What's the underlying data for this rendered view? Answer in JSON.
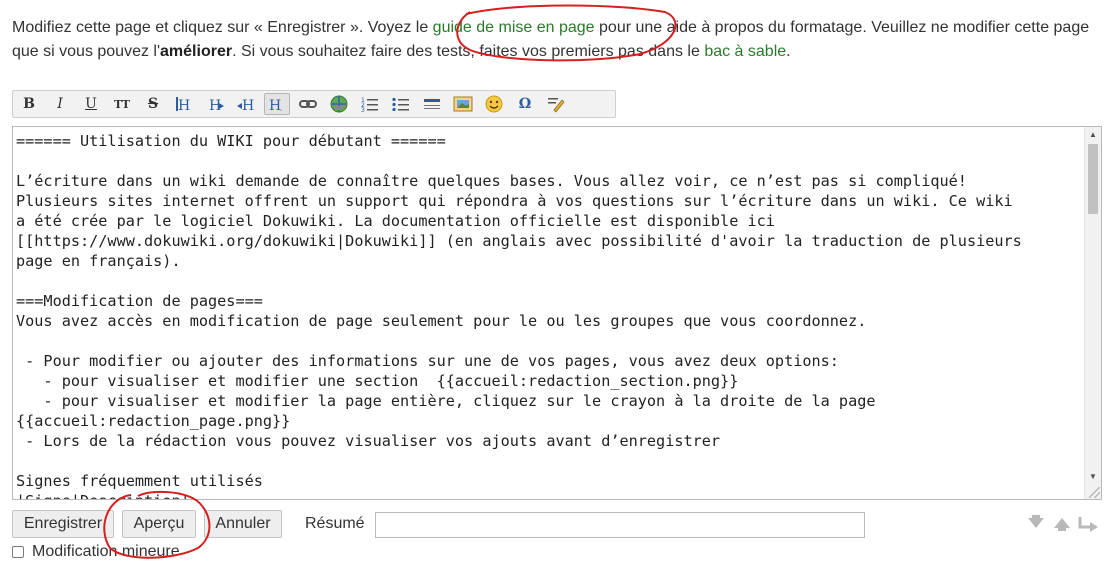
{
  "intro": {
    "t1": "Modifiez cette page et cliquez sur « Enregistrer ». Voyez le ",
    "link1": "guide de mise en page",
    "t2": " pour une aide à propos du formatage. Veuillez ne modifier cette page que si vous pouvez l'",
    "bold": "améliorer",
    "t3": ". Si vous souhaitez faire des tests, faites vos premiers pas dans le ",
    "link2": "bac à sable",
    "t4": "."
  },
  "toolbar": [
    {
      "name": "bold-button",
      "label": "B"
    },
    {
      "name": "italic-button",
      "label": "I"
    },
    {
      "name": "underline-button",
      "label": "U"
    },
    {
      "name": "monospace-button",
      "label": "TT"
    },
    {
      "name": "strikethrough-button",
      "label": "S"
    },
    {
      "name": "same-level-headline-button",
      "label": "H"
    },
    {
      "name": "lower-headline-button",
      "label": "H"
    },
    {
      "name": "higher-headline-button",
      "label": "H"
    },
    {
      "name": "headline-menu-button",
      "label": "H"
    },
    {
      "name": "internal-link-button",
      "label": "∞"
    },
    {
      "name": "external-link-button",
      "label": "◉"
    },
    {
      "name": "ordered-list-button",
      "label": "≡"
    },
    {
      "name": "unordered-list-button",
      "label": "≡"
    },
    {
      "name": "horizontal-rule-button",
      "label": "—"
    },
    {
      "name": "add-image-button",
      "label": "▣"
    },
    {
      "name": "smileys-button",
      "label": "☺"
    },
    {
      "name": "special-chars-button",
      "label": "Ω"
    },
    {
      "name": "signature-button",
      "label": "✎"
    }
  ],
  "editor": {
    "content": "====== Utilisation du WIKI pour débutant ======\n\nL’écriture dans un wiki demande de connaître quelques bases. Vous allez voir, ce n’est pas si compliqué!\nPlusieurs sites internet offrent un support qui répondra à vos questions sur l’écriture dans un wiki. Ce wiki\na été crée par le logiciel Dokuwiki. La documentation officielle est disponible ici\n[[https://www.dokuwiki.org/dokuwiki|Dokuwiki]] (en anglais avec possibilité d'avoir la traduction de plusieurs\npage en français).\n\n===Modification de pages===\nVous avez accès en modification de page seulement pour le ou les groupes que vous coordonnez.\n\n - Pour modifier ou ajouter des informations sur une de vos pages, vous avez deux options:\n   - pour visualiser et modifier une section  {{accueil:redaction_section.png}}\n   - pour visualiser et modifier la page entière, cliquez sur le crayon à la droite de la page\n{{accueil:redaction_page.png}}\n - Lors de la rédaction vous pouvez visualiser vos ajouts avant d’enregistrer\n\nSignes fréquemment utilisés\n|Signe|Description|"
  },
  "buttons": {
    "save": "Enregistrer",
    "preview": "Aperçu",
    "cancel": "Annuler"
  },
  "summary": {
    "label": "Résumé",
    "value": ""
  },
  "minor_edit": {
    "label": "Modification mineure",
    "checked": false
  },
  "colors": {
    "link": "#2b7a2b",
    "annotation": "#d42020"
  }
}
